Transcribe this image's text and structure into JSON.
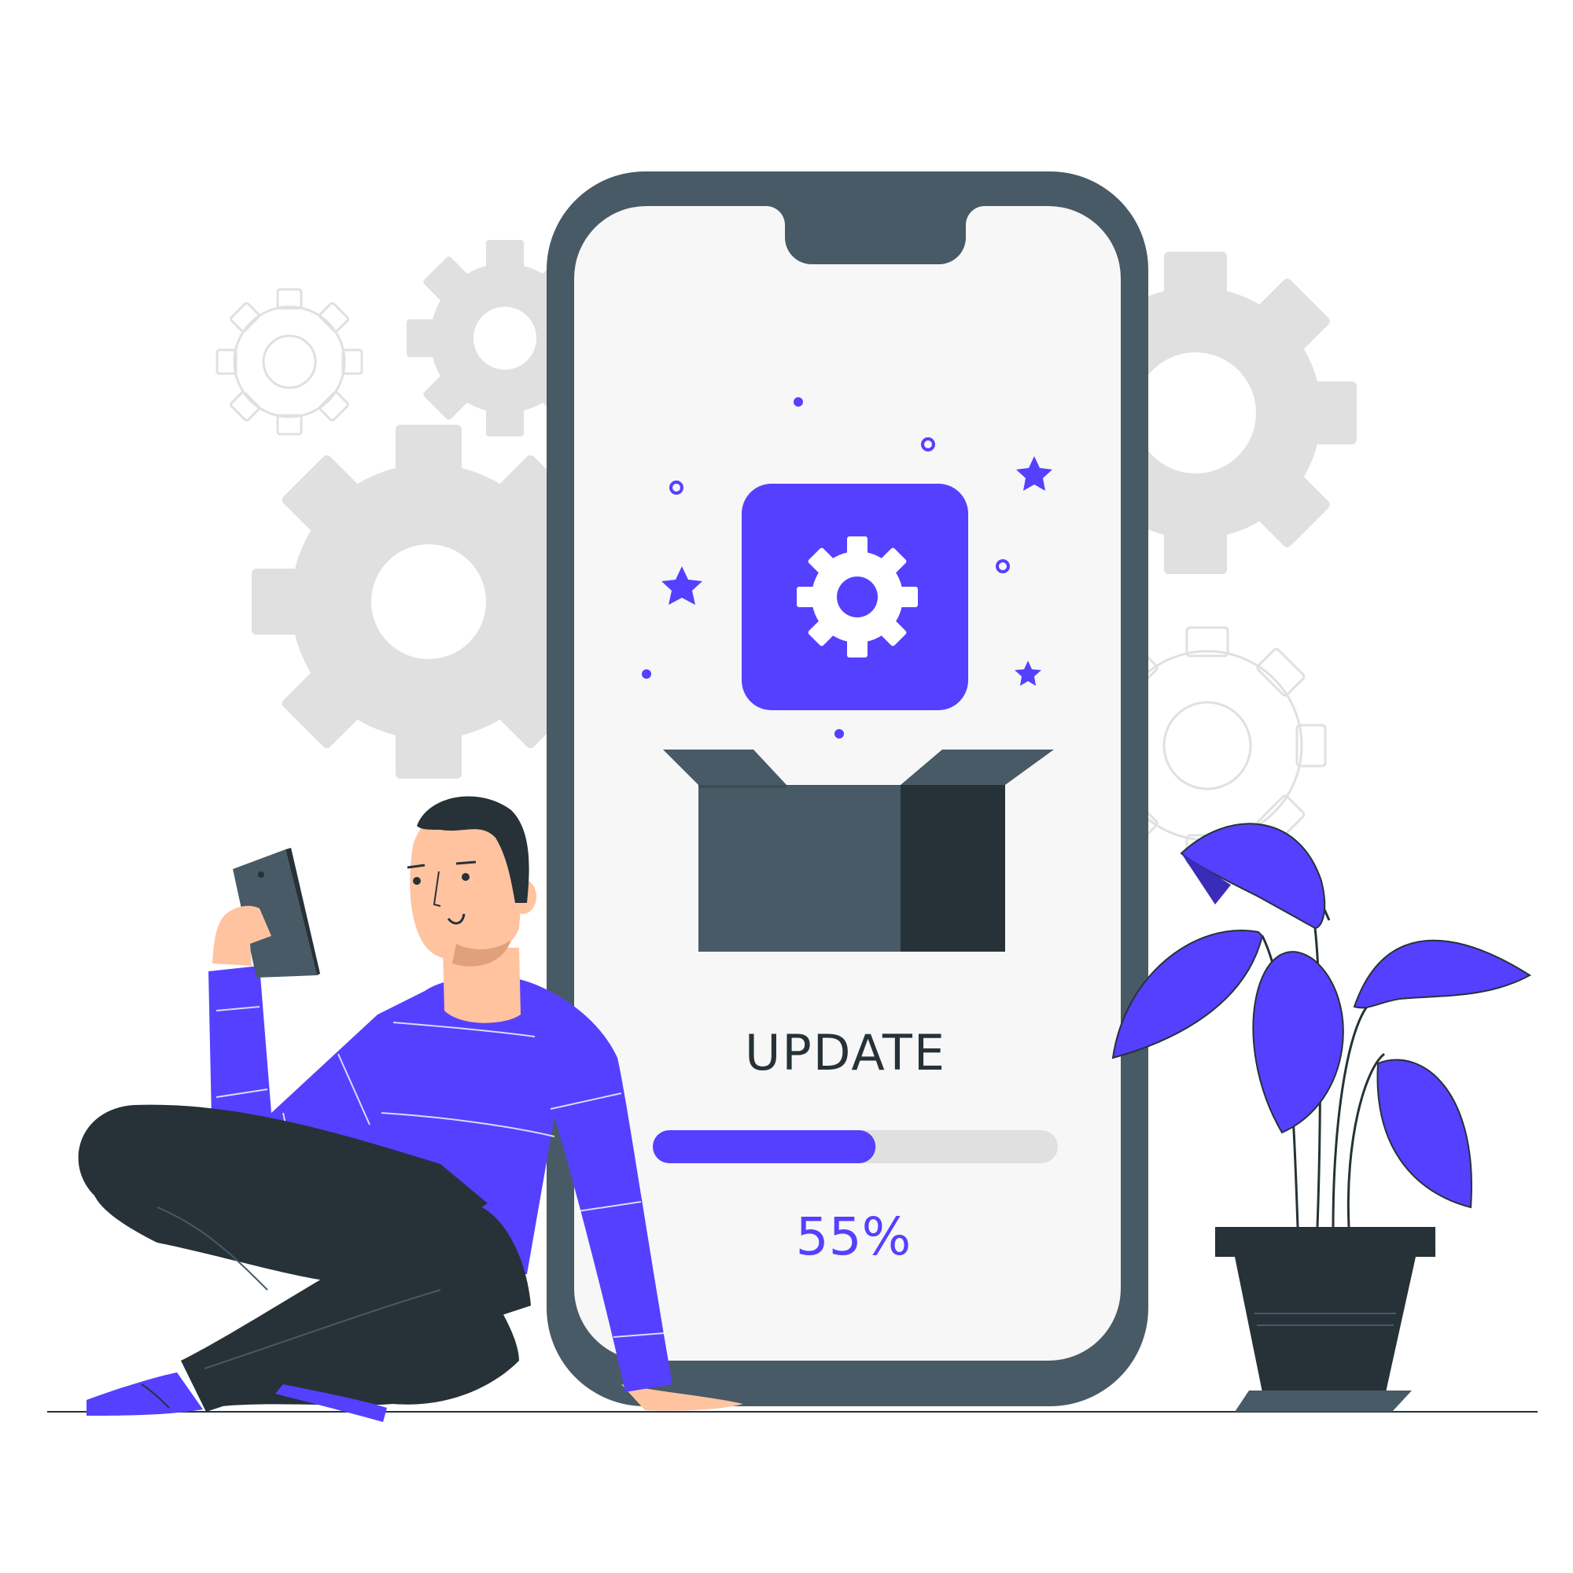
{
  "screen": {
    "title": "UPDATE",
    "progress_percent": 55,
    "progress_label": "55%"
  },
  "icons": {
    "center": "gear-icon",
    "container": "open-box-icon",
    "background": "gears-icon",
    "plant": "potted-plant-icon",
    "person": "person-with-phone-icon"
  },
  "colors": {
    "accent": "#5540FF",
    "phone_frame": "#475A66",
    "phone_screen": "#F7F7F7",
    "dark": "#263238",
    "gear_gray": "#E0E0E0",
    "track": "#E0E0E0",
    "skin": "#FFC3A0"
  }
}
